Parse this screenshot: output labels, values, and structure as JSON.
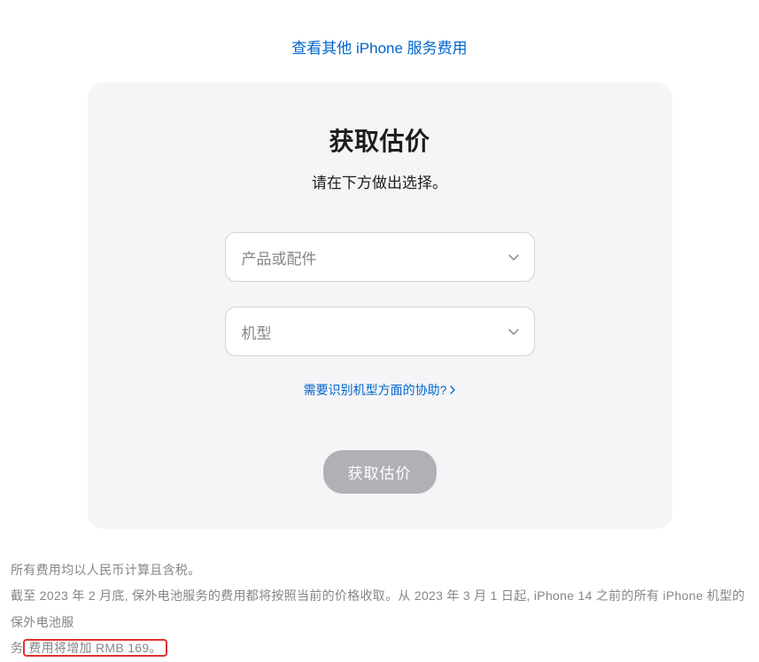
{
  "topLink": {
    "text": "查看其他 iPhone 服务费用"
  },
  "card": {
    "title": "获取估价",
    "subtitle": "请在下方做出选择。",
    "select1": {
      "placeholder": "产品或配件"
    },
    "select2": {
      "placeholder": "机型"
    },
    "helpLink": "需要识别机型方面的协助?",
    "submitButton": "获取估价"
  },
  "footer": {
    "line1": "所有费用均以人民币计算且含税。",
    "line2_part1": "截至 2023 年 2 月底, 保外电池服务的费用都将按照当前的价格收取。从 2023 年 3 月 1 日起, iPhone 14 之前的所有 iPhone 机型的保外电池服",
    "line2_part2_prefix": "务",
    "line2_highlighted": "费用将增加 RMB 169。"
  }
}
